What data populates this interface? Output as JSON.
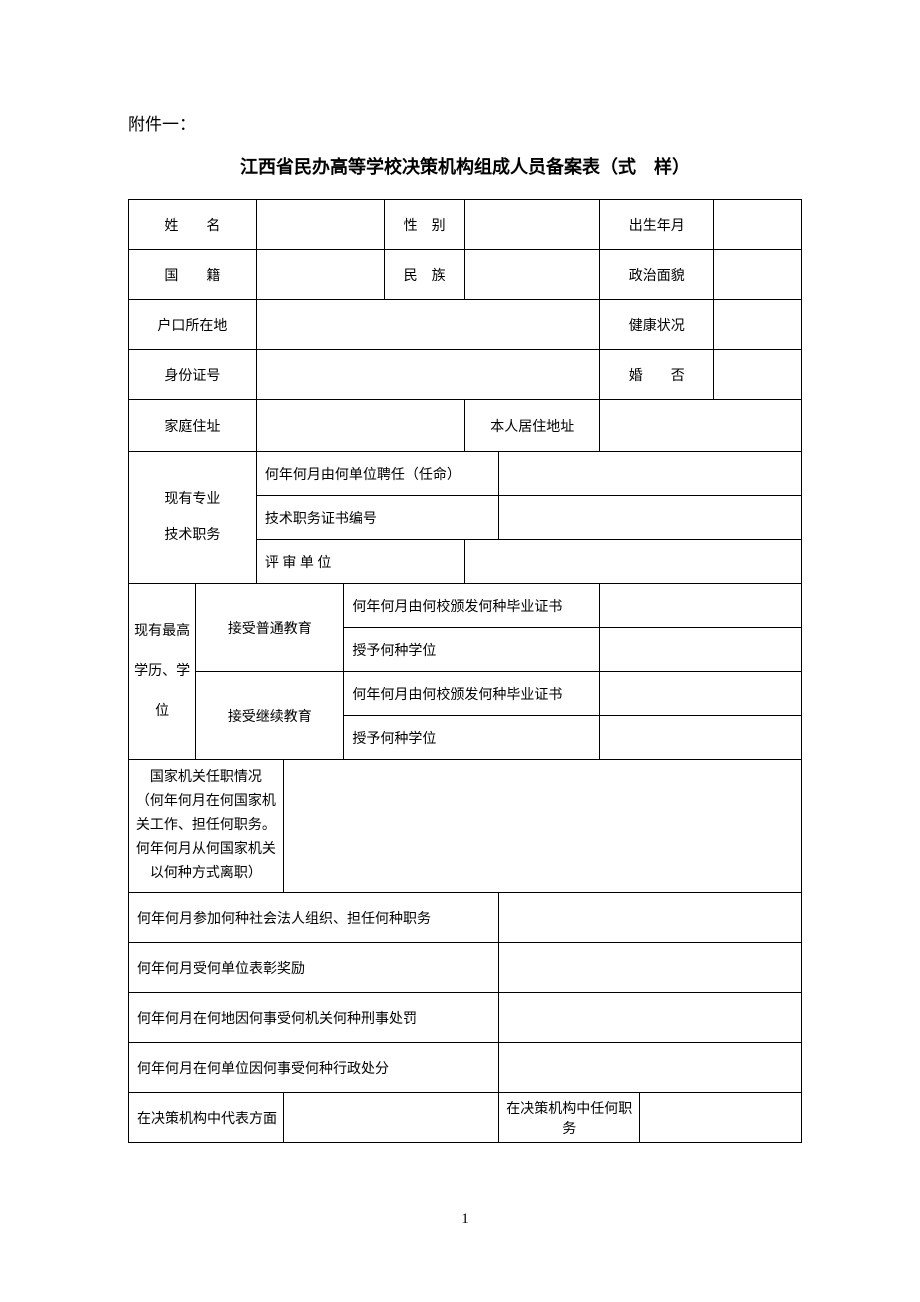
{
  "attachment": "附件一：",
  "title": "江西省民办高等学校决策机构组成人员备案表（式　样）",
  "row1": {
    "name": "姓　　名",
    "gender": "性　别",
    "birth": "出生年月"
  },
  "row2": {
    "nationality": "国　　籍",
    "ethnic": "民　族",
    "politics": "政治面貌"
  },
  "row3": {
    "hukou": "户口所在地",
    "health": "健康状况"
  },
  "row4": {
    "id": "身份证号",
    "marital": "婚　　否"
  },
  "row5": {
    "home_addr": "家庭住址",
    "curr_addr": "本人居住地址"
  },
  "tech": {
    "header": "现有专业\n技术职务",
    "appointed": "何年何月由何单位聘任（任命）",
    "cert_no": "技术职务证书编号",
    "review_unit": "评 审 单 位"
  },
  "edu": {
    "header": "现有最高\n学历、学位",
    "general": "接受普通教育",
    "continuing": "接受继续教育",
    "cert_when": "何年何月由何校颁发何种毕业证书",
    "degree": "授予何种学位"
  },
  "gov_service": "国家机关任职情况\n（何年何月在何国家机关工作、担任何职务。何年何月从何国家机关以何种方式离职）",
  "org_join": "何年何月参加何种社会法人组织、担任何种职务",
  "awards": "何年何月受何单位表彰奖励",
  "criminal": "何年何月在何地因何事受何机关何种刑事处罚",
  "admin_penalty": "何年何月在何单位因何事受何种行政处分",
  "rep_aspect": "在决策机构中代表方面",
  "rep_position": "在决策机构中任何职务",
  "page_num": "1"
}
